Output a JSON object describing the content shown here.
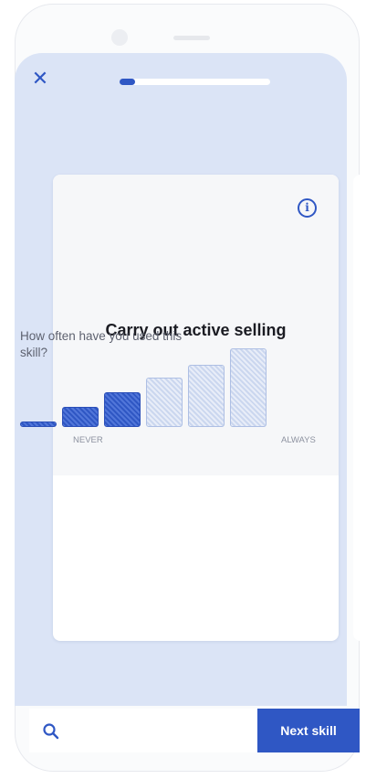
{
  "header": {
    "close_icon": "close-icon",
    "progress": 0.1
  },
  "card": {
    "skill_title": "Carry out active selling",
    "info_icon": "info-icon",
    "question": "How often have you used this skill?",
    "scale": {
      "options": 6,
      "selected": 3,
      "min_label": "NEVER",
      "max_label": "ALWAYS"
    }
  },
  "footer": {
    "search_icon": "search-icon",
    "next_label": "Next skill"
  },
  "colors": {
    "accent": "#2f57c4",
    "background": "#dbe4f6",
    "card": "#ffffff"
  }
}
